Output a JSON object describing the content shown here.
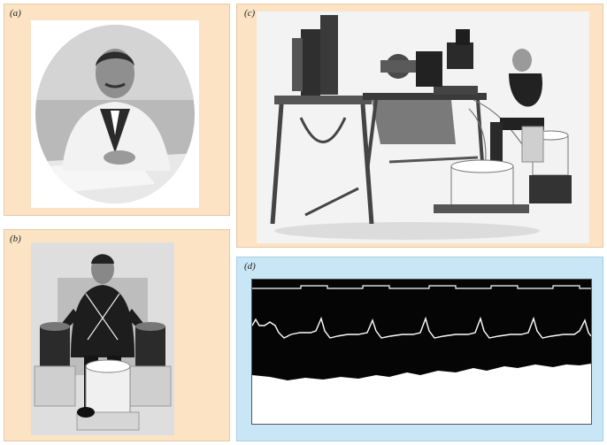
{
  "panels": {
    "a": {
      "label": "(a)"
    },
    "b": {
      "label": "(b)"
    },
    "c": {
      "label": "(c)"
    },
    "d": {
      "label": "(d)"
    }
  },
  "colors": {
    "beige_panel": "#fbe3c4",
    "blue_panel": "#c9e6f6",
    "trace_background": "#050505",
    "trace_line": "#ffffff"
  }
}
